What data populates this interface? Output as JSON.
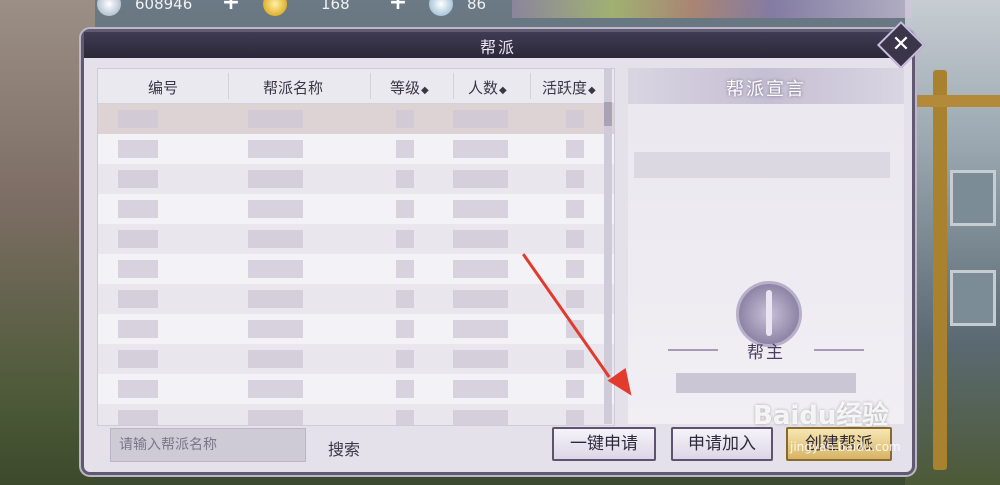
{
  "currency": {
    "silver": "608946",
    "gold": "168",
    "jade": "86"
  },
  "panel": {
    "title": "帮派",
    "close_glyph": "✕"
  },
  "table": {
    "headers": [
      "编号",
      "帮派名称",
      "等级",
      "人数",
      "活跃度"
    ],
    "sort_glyph": "◆"
  },
  "declaration": {
    "title": "帮派宣言",
    "leader_label": "帮主"
  },
  "bottom": {
    "search_placeholder": "请输入帮派名称",
    "search_label": "搜索",
    "apply_one_click": "一键申请",
    "apply_join": "申请加入",
    "create_guild": "创建帮派"
  },
  "watermark": {
    "brand": "Baidu经验",
    "url": "jingyan.baidu.com"
  },
  "colors": {
    "annotation_arrow": "#e33a2e",
    "panel_header": "#3f3b52",
    "panel_body": "#e4e1ea"
  }
}
